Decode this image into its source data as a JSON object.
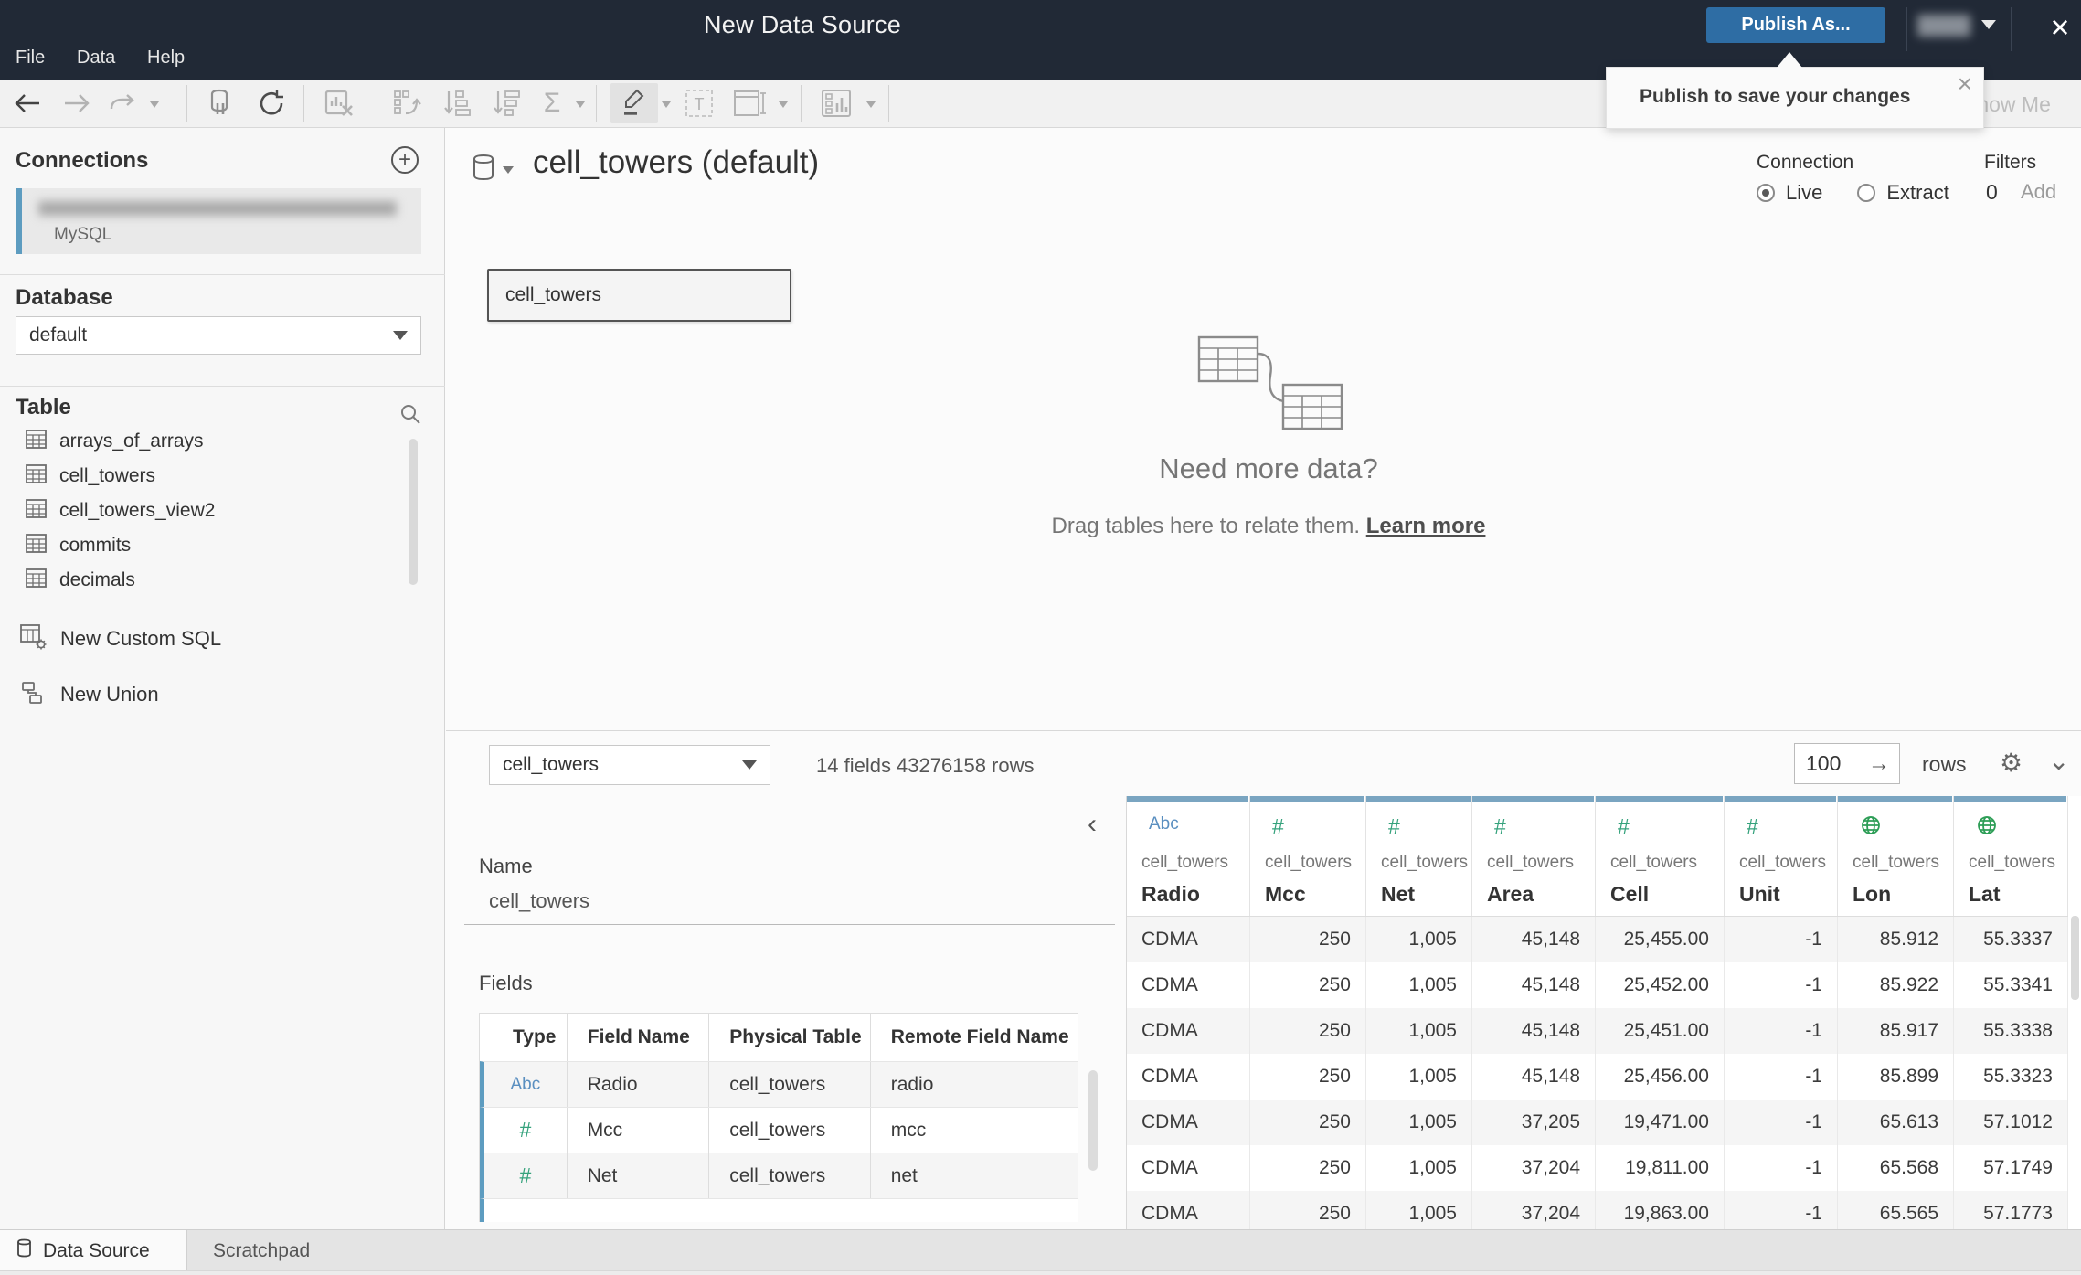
{
  "topbar": {
    "menus": [
      "File",
      "Data",
      "Help"
    ],
    "title": "New Data Source",
    "publish_button": "Publish As...",
    "close_icon": "×"
  },
  "tooltip": {
    "text": "Publish to save your changes",
    "close_icon": "×"
  },
  "toolbar": {
    "show_me": "Show Me"
  },
  "sidebar": {
    "connections": {
      "header": "Connections",
      "connection_type": "MySQL"
    },
    "database": {
      "header": "Database",
      "selected": "default"
    },
    "table": {
      "header": "Table",
      "items": [
        "arrays_of_arrays",
        "cell_towers",
        "cell_towers_view2",
        "commits",
        "decimals"
      ],
      "actions": [
        {
          "label": "New Custom SQL",
          "icon": "custom-sql-icon"
        },
        {
          "label": "New Union",
          "icon": "union-icon"
        }
      ]
    }
  },
  "canvas": {
    "datasource_title": "cell_towers (default)",
    "connection": {
      "label": "Connection",
      "options": [
        "Live",
        "Extract"
      ],
      "selected": "Live"
    },
    "filters": {
      "label": "Filters",
      "count": "0",
      "action": "Add"
    },
    "node_label": "cell_towers",
    "empty_state": {
      "heading": "Need more data?",
      "body": "Drag tables here to relate them.",
      "link": "Learn more"
    }
  },
  "metabar": {
    "table_selected": "cell_towers",
    "summary": "14 fields 43276158 rows",
    "row_count": "100",
    "rows_label": "rows"
  },
  "details": {
    "collapse_icon": "‹",
    "name_label": "Name",
    "name_value": "cell_towers",
    "fields_label": "Fields",
    "fields_columns": [
      "Type",
      "Field Name",
      "Physical Table",
      "Remote Field Name"
    ],
    "fields_rows": [
      {
        "type": "Abc",
        "field": "Radio",
        "table": "cell_towers",
        "remote": "radio"
      },
      {
        "type": "#",
        "field": "Mcc",
        "table": "cell_towers",
        "remote": "mcc"
      },
      {
        "type": "#",
        "field": "Net",
        "table": "cell_towers",
        "remote": "net"
      }
    ]
  },
  "grid": {
    "columns": [
      {
        "type": "Abc",
        "source": "cell_towers",
        "name": "Radio"
      },
      {
        "type": "#",
        "source": "cell_towers",
        "name": "Mcc"
      },
      {
        "type": "#",
        "source": "cell_towers",
        "name": "Net"
      },
      {
        "type": "#",
        "source": "cell_towers",
        "name": "Area"
      },
      {
        "type": "#",
        "source": "cell_towers",
        "name": "Cell"
      },
      {
        "type": "#",
        "source": "cell_towers",
        "name": "Unit"
      },
      {
        "type": "globe",
        "source": "cell_towers",
        "name": "Lon"
      },
      {
        "type": "globe",
        "source": "cell_towers",
        "name": "Lat"
      }
    ],
    "rows": [
      [
        "CDMA",
        "250",
        "1,005",
        "45,148",
        "25,455.00",
        "-1",
        "85.912",
        "55.3337"
      ],
      [
        "CDMA",
        "250",
        "1,005",
        "45,148",
        "25,452.00",
        "-1",
        "85.922",
        "55.3341"
      ],
      [
        "CDMA",
        "250",
        "1,005",
        "45,148",
        "25,451.00",
        "-1",
        "85.917",
        "55.3338"
      ],
      [
        "CDMA",
        "250",
        "1,005",
        "45,148",
        "25,456.00",
        "-1",
        "85.899",
        "55.3323"
      ],
      [
        "CDMA",
        "250",
        "1,005",
        "37,205",
        "19,471.00",
        "-1",
        "65.613",
        "57.1012"
      ],
      [
        "CDMA",
        "250",
        "1,005",
        "37,204",
        "19,811.00",
        "-1",
        "65.568",
        "57.1749"
      ],
      [
        "CDMA",
        "250",
        "1,005",
        "37,204",
        "19,863.00",
        "-1",
        "65.565",
        "57.1773"
      ]
    ]
  },
  "tabs": [
    {
      "label": "Data Source",
      "active": true
    },
    {
      "label": "Scratchpad",
      "active": false
    }
  ],
  "colors": {
    "topbar_bg": "#212936",
    "publish_blue": "#2e6da4",
    "accent_blue_bar": "#5d9cc0",
    "grid_header_blue": "#7aa5c1",
    "type_string_blue": "#5a8fc0",
    "type_number_green": "#35a27c",
    "type_geo_green": "#2e9e57"
  }
}
